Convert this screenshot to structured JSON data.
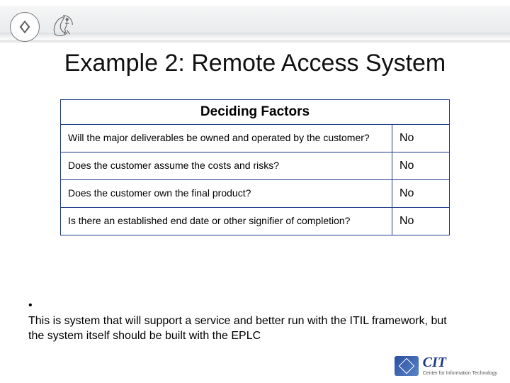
{
  "title": "Example 2: Remote Access System",
  "table": {
    "header": "Deciding Factors",
    "rows": [
      {
        "q": "Will the major deliverables be owned and operated by the customer?",
        "a": "No"
      },
      {
        "q": "Does the customer assume the costs and risks?",
        "a": "No"
      },
      {
        "q": "Does the customer own the final product?",
        "a": "No"
      },
      {
        "q": "Is there an established end date or other signifier of completion?",
        "a": "No"
      }
    ]
  },
  "bullet": "This is system that will support a service and better run with the ITIL framework, but the system itself should be built with the EPLC",
  "footer": {
    "cit": "CIT",
    "sub": "Center for Information Technology"
  }
}
